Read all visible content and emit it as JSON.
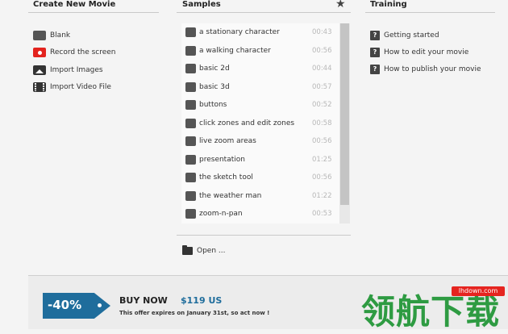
{
  "create": {
    "heading": "Create New Movie",
    "items": [
      {
        "label": "Blank",
        "icon": "blank-movie-icon"
      },
      {
        "label": "Record the screen",
        "icon": "record-icon"
      },
      {
        "label": "Import Images",
        "icon": "image-icon"
      },
      {
        "label": "Import Video File",
        "icon": "film-icon"
      }
    ]
  },
  "samples": {
    "heading": "Samples",
    "items": [
      {
        "label": "a stationary character",
        "duration": "00:43"
      },
      {
        "label": "a walking character",
        "duration": "00:56"
      },
      {
        "label": "basic 2d",
        "duration": "00:44"
      },
      {
        "label": "basic 3d",
        "duration": "00:57"
      },
      {
        "label": "buttons",
        "duration": "00:52"
      },
      {
        "label": "click zones and edit zones",
        "duration": "00:58"
      },
      {
        "label": "live zoom areas",
        "duration": "00:56"
      },
      {
        "label": "presentation",
        "duration": "01:25"
      },
      {
        "label": "the sketch tool",
        "duration": "00:56"
      },
      {
        "label": "the weather man",
        "duration": "01:22"
      },
      {
        "label": "zoom-n-pan",
        "duration": "00:53"
      }
    ],
    "open_label": "Open ..."
  },
  "training": {
    "heading": "Training",
    "items": [
      {
        "label": "Getting started"
      },
      {
        "label": "How to edit your movie"
      },
      {
        "label": "How to publish your movie"
      }
    ]
  },
  "promo": {
    "discount": "-40%",
    "buy_label": "BUY NOW",
    "price": "$119 US",
    "offer_text": "This offer expires on January 31st, so act now !",
    "accent_color": "#1f6d9c"
  },
  "watermark": {
    "site": "lhdown.com",
    "text": "领航下载"
  }
}
